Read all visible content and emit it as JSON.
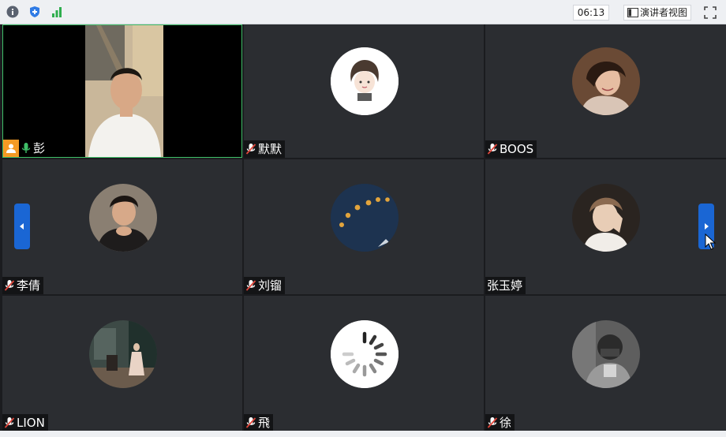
{
  "toolbar": {
    "timer": "06:13",
    "speaker_view_label": "演讲者视图"
  },
  "participants": [
    {
      "name": "彭",
      "muted": false,
      "active": true,
      "host": true
    },
    {
      "name": "默默",
      "muted": true
    },
    {
      "name": "BOOS",
      "muted": true
    },
    {
      "name": "李倩",
      "muted": true
    },
    {
      "name": "刘镏",
      "muted": true
    },
    {
      "name": "张玉婷",
      "muted": false,
      "no_mic_icon": true
    },
    {
      "name": "LION",
      "muted": true
    },
    {
      "name": "飛",
      "muted": true
    },
    {
      "name": "徐",
      "muted": true
    }
  ],
  "colors": {
    "active_border": "#3fbf68",
    "nav_button": "#1a66d4",
    "host_badge": "#f59a23",
    "mic_on": "#3fbf68",
    "mic_muted": "#e0453a"
  }
}
